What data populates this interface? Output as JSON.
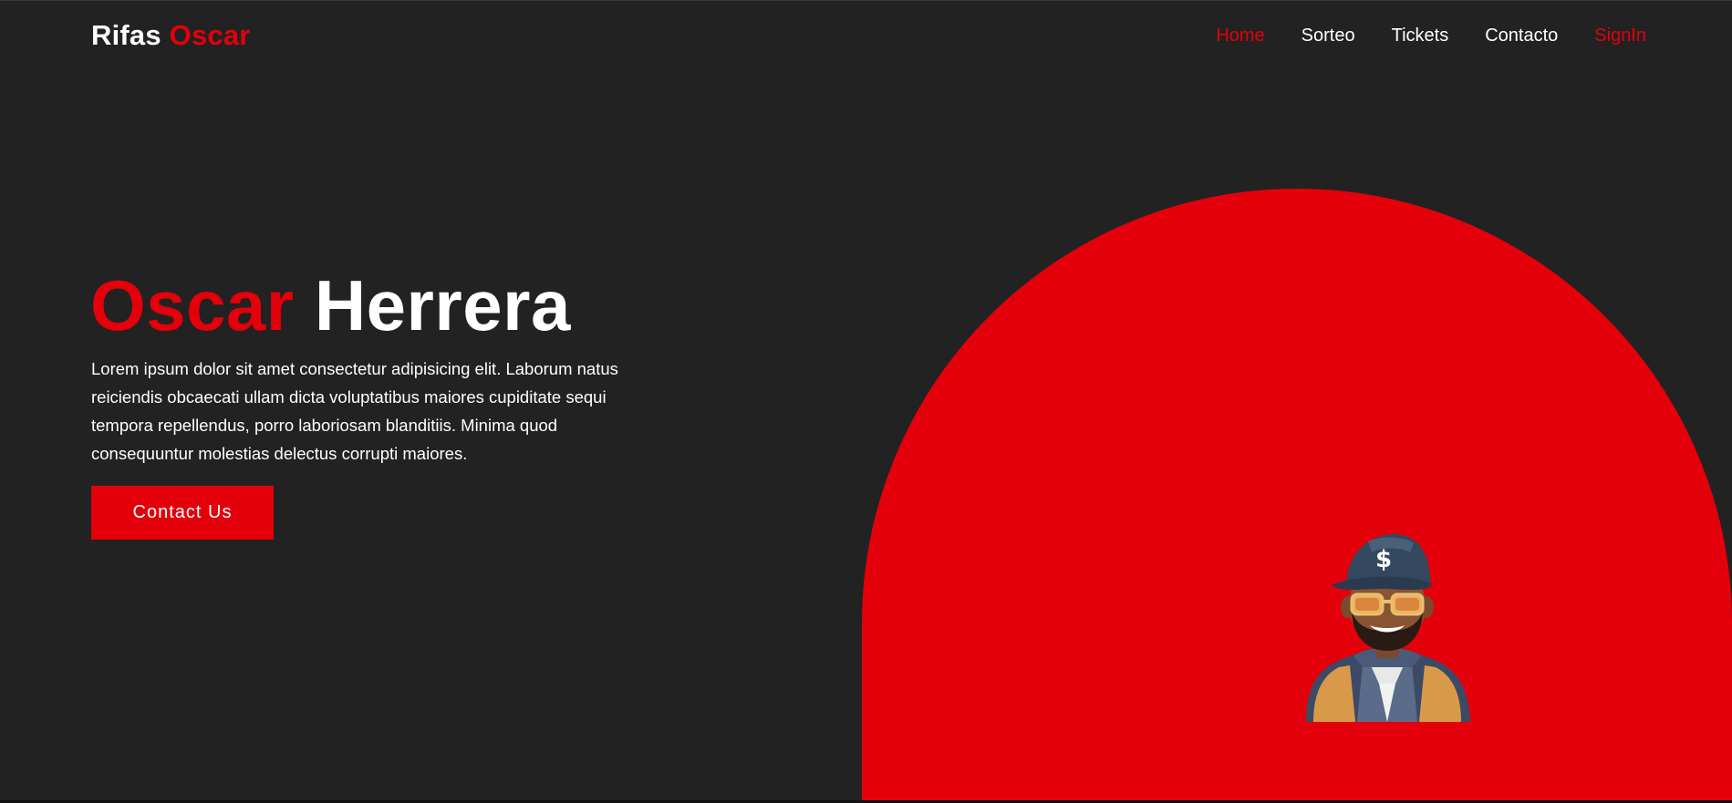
{
  "header": {
    "brand_main": "Rifas",
    "brand_accent": "Oscar",
    "nav": [
      {
        "label": "Home"
      },
      {
        "label": "Sorteo"
      },
      {
        "label": "Tickets"
      },
      {
        "label": "Contacto"
      },
      {
        "label": "SignIn"
      }
    ]
  },
  "hero": {
    "title_accent": "Oscar",
    "title_main": "Herrera",
    "description": "Lorem ipsum dolor sit amet consectetur adipisicing elit. Laborum natus reiciendis obcaecati ullam dicta voluptatibus maiores cupiditate sequi tempora repellendus, porro laboriosam blanditiis. Minima quod consequuntur molestias delectus corrupti maiores.",
    "cta_label": "Contact Us"
  },
  "colors": {
    "background": "#222222",
    "accent": "#e3000b",
    "text": "#ffffff"
  },
  "icons": {
    "hero_image": "cartoon-man-with-cap-and-sunglasses-avatar"
  }
}
